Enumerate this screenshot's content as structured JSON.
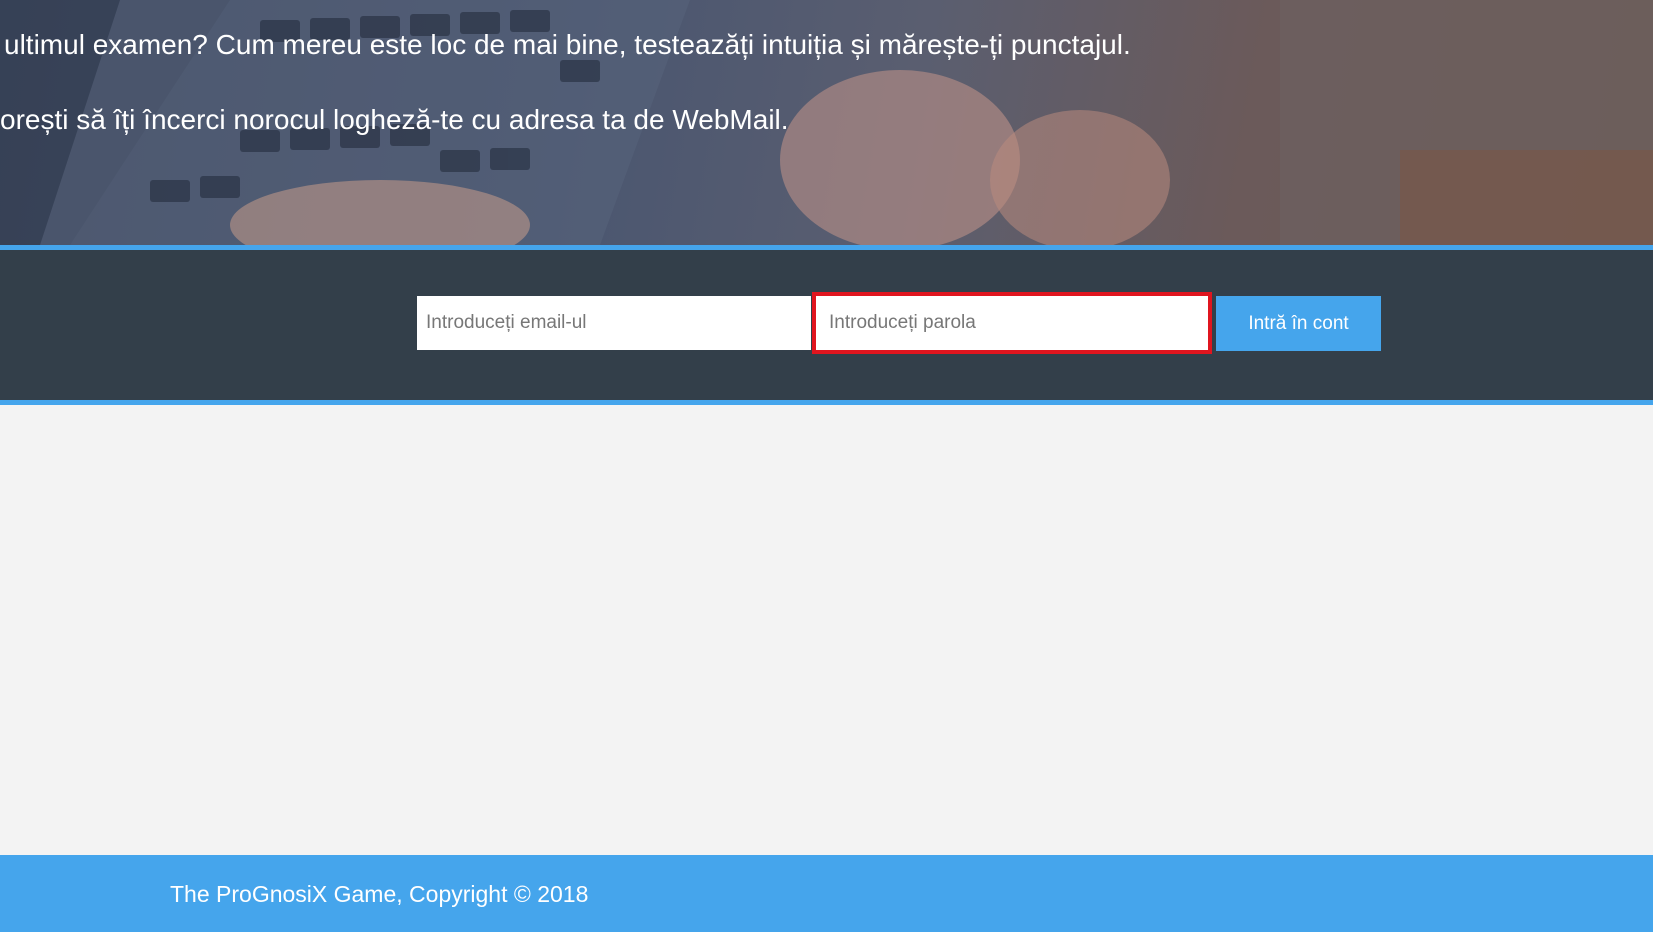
{
  "hero": {
    "line1": "ultimul examen? Cum mereu este loc de mai bine, testeazăți intuiția și mărește-ți punctajul.",
    "line2": "orești să îți încerci norocul logheză-te cu adresa ta de WebMail."
  },
  "login": {
    "email_placeholder": "Introduceți email-ul",
    "password_placeholder": "Introduceți parola",
    "submit_label": "Intră în cont"
  },
  "footer": {
    "copyright": "The ProGnosiX Game, Copyright © 2018"
  },
  "colors": {
    "accent": "#45a5ec",
    "band": "#333f4a",
    "highlight": "#e0151f",
    "background": "#f3f3f3"
  }
}
